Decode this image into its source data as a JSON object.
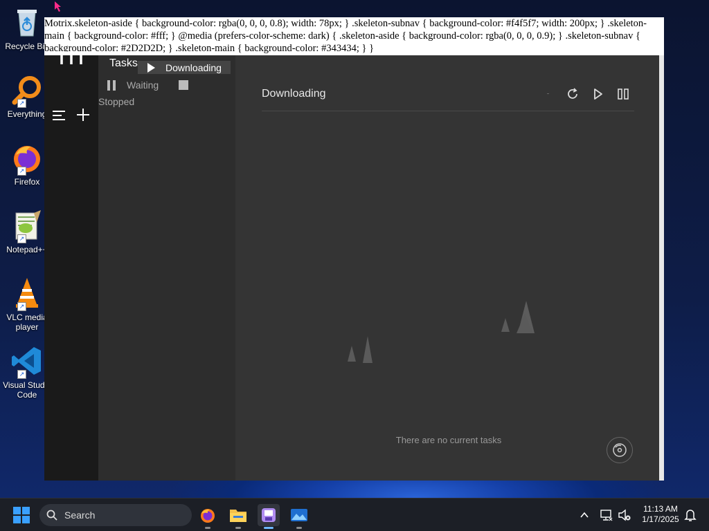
{
  "desktop": {
    "icons": [
      {
        "label": "Recycle Bin",
        "icon": "recycle-bin-icon"
      },
      {
        "label": "Everything",
        "icon": "everything-search-icon"
      },
      {
        "label": "Firefox",
        "icon": "firefox-icon"
      },
      {
        "label": "Notepad++",
        "icon": "notepad-plus-plus-icon"
      },
      {
        "label": "VLC media player",
        "icon": "vlc-icon"
      },
      {
        "label": "Visual Studio Code",
        "icon": "vscode-icon"
      }
    ]
  },
  "app": {
    "css_text": "Motrix.skeleton-aside { background-color: rgba(0, 0, 0, 0.8); width: 78px; } .skeleton-subnav { background-color: #f4f5f7; width: 200px; } .skeleton-main { background-color: #fff; } @media (prefers-color-scheme: dark) { .skeleton-aside { background-color: rgba(0, 0, 0, 0.9); } .skeleton-subnav { background-color: #2D2D2D; } .skeleton-main { background-color: #343434; } }",
    "subnav": {
      "title": "Tasks",
      "items": [
        {
          "label": "Downloading",
          "icon": "play-icon"
        },
        {
          "label": "Waiting",
          "icon": "pause-icon"
        },
        {
          "label": "Stopped",
          "icon": "stop-icon"
        }
      ]
    },
    "main": {
      "title": "Downloading",
      "empty_message": "There are no current tasks",
      "actions": [
        "refresh-icon",
        "resume-all-icon",
        "pause-all-icon"
      ]
    }
  },
  "taskbar": {
    "search_placeholder": "Search",
    "time": "11:13 AM",
    "date": "1/17/2025",
    "apps": [
      "firefox-icon",
      "file-explorer-icon",
      "motrix-icon",
      "photos-icon"
    ]
  }
}
